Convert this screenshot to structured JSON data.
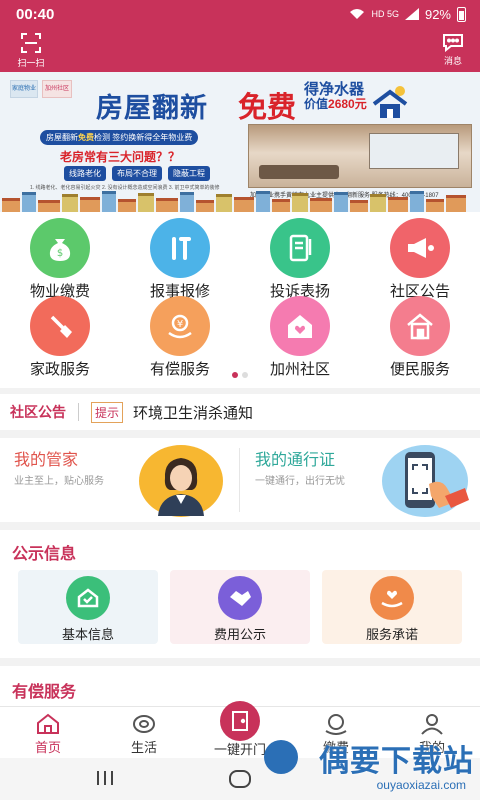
{
  "status_bar": {
    "time": "00:40",
    "network": "HD 5G",
    "battery": "92%"
  },
  "header": {
    "scan_label": "扫一扫",
    "message_label": "消息"
  },
  "banner": {
    "logo1": "家庭物业",
    "logo2": "加州社区",
    "headline_left": "房屋翻新",
    "headline_right": "免费",
    "gift_line1": "得净水器",
    "gift_line2_prefix": "价值",
    "gift_price": "2680元",
    "promo_prefix": "房屋翻新",
    "promo_highlight": "免费",
    "promo_suffix": "检测 签约换新得全年物业费",
    "question": "老房常有三大问题？？",
    "chips": [
      "线路老化",
      "布局不合理",
      "隐蔽工程"
    ],
    "fine_print": "1. 线路老化、老化容易引起火灾  2. 没有设计概念造成空间浪费  3. 前卫中式简单的装修",
    "caption": "加州物业携手黄镇在九业主提供房屋翻新服务    服务热线：400-118-1807"
  },
  "grid": {
    "items": [
      {
        "label": "物业缴费",
        "icon": "money-bag-icon",
        "color": "#5cc96b"
      },
      {
        "label": "报事报修",
        "icon": "tools-icon",
        "color": "#4cb3e8"
      },
      {
        "label": "投诉表扬",
        "icon": "notebook-icon",
        "color": "#39c48a"
      },
      {
        "label": "社区公告",
        "icon": "megaphone-icon",
        "color": "#f0646a"
      },
      {
        "label": "家政服务",
        "icon": "broom-icon",
        "color": "#f26b5b"
      },
      {
        "label": "有偿服务",
        "icon": "yuan-hand-icon",
        "color": "#f5a05c"
      },
      {
        "label": "加州社区",
        "icon": "heart-house-icon",
        "color": "#f57bb0"
      },
      {
        "label": "便民服务",
        "icon": "home-service-icon",
        "color": "#f47d8e"
      }
    ]
  },
  "notice": {
    "title": "社区公告",
    "tag": "提示",
    "text": "环境卫生消杀通知"
  },
  "cards": {
    "butler": {
      "title": "我的管家",
      "subtitle": "业主至上，贴心服务"
    },
    "pass": {
      "title": "我的通行证",
      "subtitle": "一键通行，出行无忧"
    }
  },
  "public_info": {
    "title": "公示信息",
    "items": [
      {
        "label": "基本信息",
        "icon": "house-check-icon",
        "color": "#3bbf7a",
        "bg": "#eef7f2"
      },
      {
        "label": "费用公示",
        "icon": "handshake-icon",
        "color": "#7b5fd9",
        "bg": "#fbeef0"
      },
      {
        "label": "服务承诺",
        "icon": "heart-hand-icon",
        "color": "#f08a4a",
        "bg": "#fdf1e6"
      }
    ]
  },
  "paid_section": {
    "title": "有偿服务"
  },
  "tabbar": {
    "tabs": [
      {
        "label": "首页",
        "icon": "home-icon"
      },
      {
        "label": "生活",
        "icon": "life-icon"
      },
      {
        "label": "一键开门",
        "icon": "door-icon"
      },
      {
        "label": "缴费",
        "icon": "payment-icon"
      },
      {
        "label": "我的",
        "icon": "user-icon"
      }
    ]
  },
  "watermark": {
    "title": "偶要下载站",
    "url": "ouyaoxiazai.com"
  },
  "colors": {
    "brand": "#c8325a",
    "active_tab": "#c8325a"
  }
}
